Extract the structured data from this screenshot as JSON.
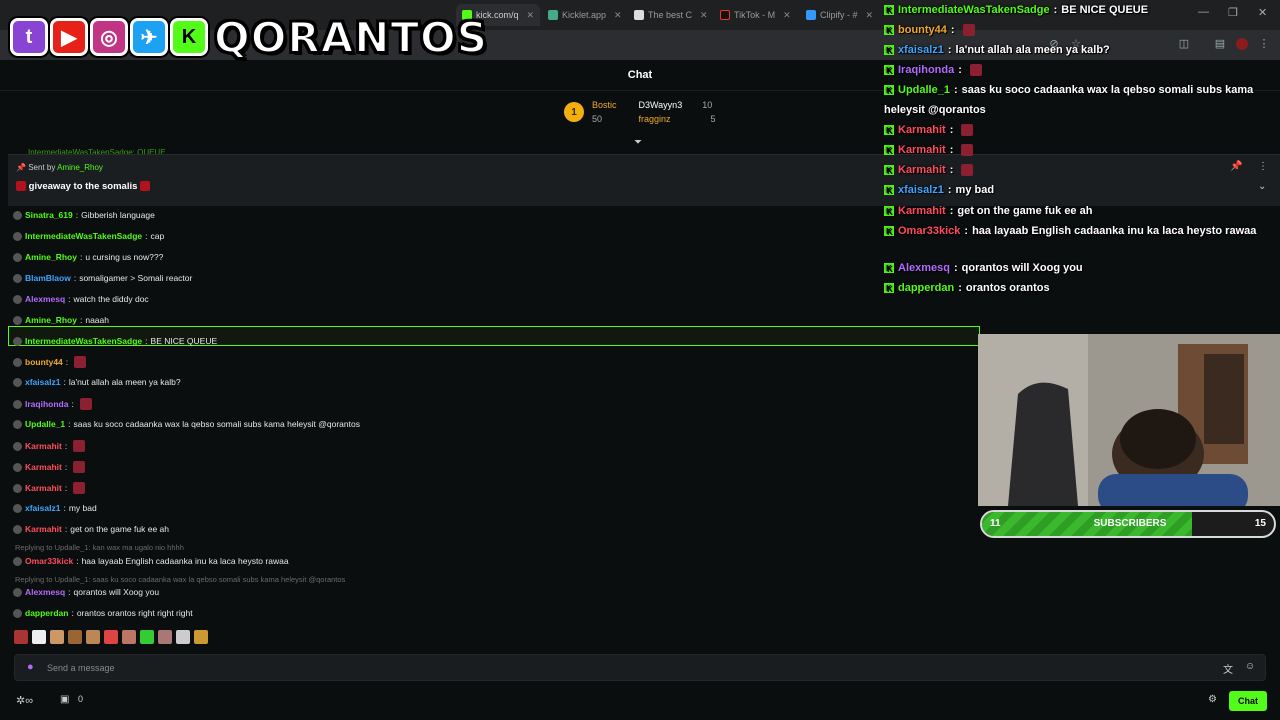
{
  "browser": {
    "tabs": [
      {
        "label": "kick.com/q"
      },
      {
        "label": "Kicklet.app"
      },
      {
        "label": "The best C"
      },
      {
        "label": "TikTok - M"
      },
      {
        "label": "Clipify - #"
      }
    ],
    "overflow_tab": "BE NICE QUEUE"
  },
  "logo": {
    "text": "QORANTOS"
  },
  "chat": {
    "title": "Chat",
    "leaderboard": {
      "first": {
        "name": "Bostic",
        "value": "50"
      },
      "second": {
        "name": "D3Wayyn3",
        "value": "10"
      },
      "third": {
        "name": "fragginz",
        "value": "5"
      }
    },
    "pinned": {
      "sent_by_prefix": "Sent by",
      "sent_by_user": "Amine_Rhoy",
      "message": "giveaway to the somalis",
      "ghost": "IntermediateWasTakenSadge: QUEUE"
    },
    "messages": [
      {
        "user": "Sinatra_619",
        "color": "#53fc18",
        "text": "Gibberish language"
      },
      {
        "user": "IntermediateWasTakenSadge",
        "color": "#53fc18",
        "text": "cap"
      },
      {
        "user": "Amine_Rhoy",
        "color": "#53fc18",
        "text": "u cursing us now???"
      },
      {
        "user": "BlamBlaow",
        "color": "#3ea6ff",
        "text": "somaligamer > Somali reactor"
      },
      {
        "user": "Alexmesq",
        "color": "#b36bff",
        "text": "watch the diddy doc"
      },
      {
        "user": "Amine_Rhoy",
        "color": "#53fc18",
        "text": "naaah"
      },
      {
        "user": "IntermediateWasTakenSadge",
        "color": "#53fc18",
        "text": "BE NICE QUEUE"
      },
      {
        "user": "bounty44",
        "color": "#f0a830",
        "text": ""
      },
      {
        "user": "xfaisalz1",
        "color": "#3ea6ff",
        "text": "la'nut allah ala meen ya kalb?"
      },
      {
        "user": "Iraqihonda",
        "color": "#b36bff",
        "text": ""
      },
      {
        "user": "Updalle_1",
        "color": "#53fc18",
        "text": "saas ku soco cadaanka wax la qebso somali subs kama heleysit @qorantos"
      },
      {
        "user": "Karmahit",
        "color": "#ff4d5e",
        "text": ""
      },
      {
        "user": "Karmahit",
        "color": "#ff4d5e",
        "text": ""
      },
      {
        "user": "Karmahit",
        "color": "#ff4d5e",
        "text": ""
      },
      {
        "user": "xfaisalz1",
        "color": "#3ea6ff",
        "text": "my bad"
      },
      {
        "user": "Karmahit",
        "color": "#ff4d5e",
        "text": "get on the game fuk ee ah"
      },
      {
        "user": "Omar33kick",
        "color": "#ff4d5e",
        "text": "haa layaab English cadaanka inu ka laca heysto rawaa"
      },
      {
        "user": "Alexmesq",
        "color": "#b36bff",
        "text": "qorantos will Xoog you"
      },
      {
        "user": "dapperdan",
        "color": "#53fc18",
        "text": "orantos orantos right right right"
      }
    ],
    "replies": [
      "Replying to Updalle_1: kan wax ma ugalo nio hhhh",
      "Replying to Updalle_1: saas ku soco cadaanka wax la qebso somali subs kama heleysit @qorantos"
    ],
    "composer_placeholder": "Send a message",
    "points": "0",
    "chat_button": "Chat"
  },
  "overlay_chat": [
    {
      "user": "IntermediateWasTakenSadge",
      "color": "#53fc18",
      "text": "BE NICE QUEUE"
    },
    {
      "user": "bounty44",
      "color": "#f0a830",
      "text": ""
    },
    {
      "user": "xfaisalz1",
      "color": "#3ea6ff",
      "text": "la'nut allah ala meen ya kalb?"
    },
    {
      "user": "Iraqihonda",
      "color": "#b36bff",
      "text": ""
    },
    {
      "user": "Updalle_1",
      "color": "#53fc18",
      "text": "saas ku soco cadaanka wax la qebso somali subs kama"
    },
    {
      "user": "",
      "color": "#fff",
      "text": "heleysit @qorantos"
    },
    {
      "user": "Karmahit",
      "color": "#ff4d5e",
      "text": ""
    },
    {
      "user": "Karmahit",
      "color": "#ff4d5e",
      "text": ""
    },
    {
      "user": "Karmahit",
      "color": "#ff4d5e",
      "text": ""
    },
    {
      "user": "xfaisalz1",
      "color": "#3ea6ff",
      "text": "my bad"
    },
    {
      "user": "Karmahit",
      "color": "#ff4d5e",
      "text": "get on the game fuk ee ah"
    },
    {
      "user": "Omar33kick",
      "color": "#ff4d5e",
      "text": "haa layaab English cadaanka inu ka laca heysto rawaa"
    },
    {
      "user": "Alexmesq",
      "color": "#b36bff",
      "text": "qorantos will Xoog you"
    },
    {
      "user": "dapperdan",
      "color": "#53fc18",
      "text": "orantos orantos"
    }
  ],
  "sub_goal": {
    "current": "11",
    "label": "SUBSCRIBERS",
    "target": "15",
    "progress": 0.72
  }
}
